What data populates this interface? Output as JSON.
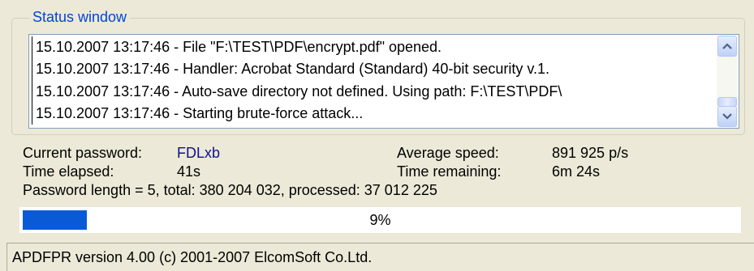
{
  "status_window": {
    "title": "Status window",
    "log_lines": [
      "15.10.2007 13:17:46 - File \"F:\\TEST\\PDF\\encrypt.pdf\" opened.",
      "15.10.2007 13:17:46 - Handler: Acrobat Standard (Standard) 40-bit security v.1.",
      "15.10.2007 13:17:46 - Auto-save directory not defined. Using path: F:\\TEST\\PDF\\",
      "15.10.2007 13:17:46 - Starting brute-force attack..."
    ],
    "scrollbar": {
      "up_icon": "chevron-up-icon",
      "down_icon": "chevron-down-icon"
    }
  },
  "info": {
    "current_password_label": "Current password:",
    "current_password_value": "FDLxb",
    "time_elapsed_label": "Time elapsed:",
    "time_elapsed_value": "41s",
    "average_speed_label": "Average speed:",
    "average_speed_value": "891 925 p/s",
    "time_remaining_label": "Time remaining:",
    "time_remaining_value": "6m 24s",
    "summary": "Password length = 5, total: 380 204 032, processed: 37 012 225"
  },
  "progress": {
    "percent": 9,
    "label": "9%",
    "fill_color": "#0a5ad8"
  },
  "statusbar": {
    "text": "APDFPR version 4.00 (c) 2001-2007 ElcomSoft Co.Ltd."
  },
  "colors": {
    "accent_title": "#0046d5",
    "password_value": "#101090"
  }
}
